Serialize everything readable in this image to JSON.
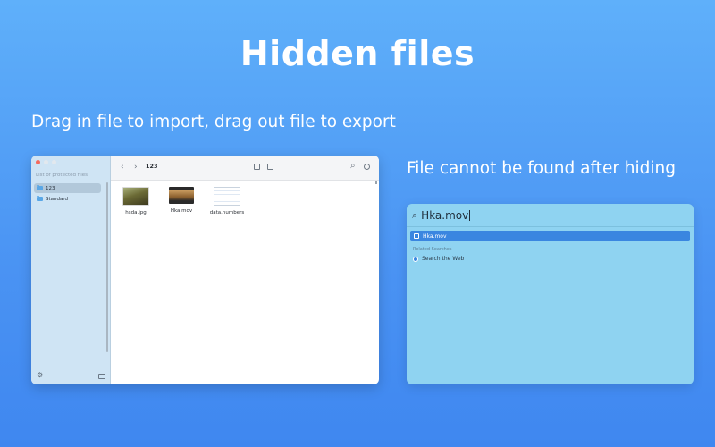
{
  "hero": {
    "title": "Hidden files"
  },
  "captions": {
    "left": "Drag in file to import, drag out file to export",
    "right": "File cannot be found after hiding"
  },
  "finder_window": {
    "sidebar": {
      "heading": "List of protected files",
      "items": [
        {
          "label": "123",
          "icon": "folder-icon",
          "selected": true
        },
        {
          "label": "Standard",
          "icon": "folder-icon",
          "selected": false
        }
      ],
      "footer_icons": [
        "gear-icon",
        "import-icon"
      ]
    },
    "toolbar": {
      "back_icon": "‹",
      "forward_icon": "›",
      "title": "123",
      "search_icon": "⌕"
    },
    "files": [
      {
        "name": "hsda.jpg",
        "thumb": "photo"
      },
      {
        "name": "Hka.mov",
        "thumb": "video"
      },
      {
        "name": "data.numbers",
        "thumb": "spreadsheet"
      }
    ]
  },
  "spotlight": {
    "search_icon": "⌕",
    "query": "Hka.mov",
    "top_hit": "Hka.mov",
    "related_label": "Related Searches",
    "web_search": "Search the Web"
  }
}
